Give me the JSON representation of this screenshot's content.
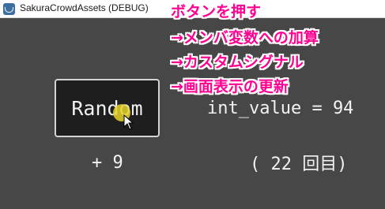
{
  "window": {
    "title": "SakuraCrowdAssets (DEBUG)"
  },
  "game": {
    "random_button_label": "Random",
    "int_value_text": "int_value = 94",
    "delta_text": "+ 9",
    "count_text": "( 22 回目)"
  },
  "annotations": [
    "ボタンを押す",
    "→メンバ変数への加算",
    "→カスタムシグナル",
    "→画面表示の更新"
  ],
  "colors": {
    "background": "#474747",
    "button_bg": "#1e1e1e",
    "button_border": "#d3d3d3",
    "annotation": "#ff0090",
    "cursor_highlight": "#e6d228"
  }
}
